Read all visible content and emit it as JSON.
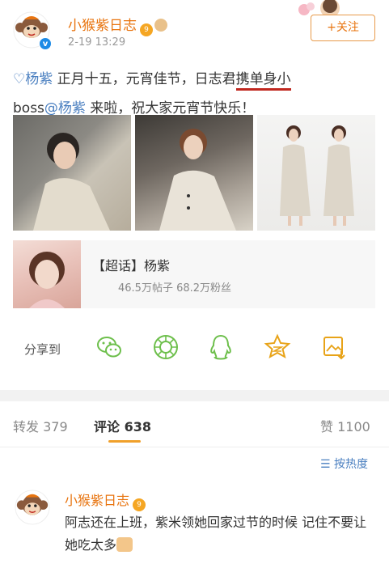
{
  "post": {
    "username": "小猴紫日志",
    "timestamp": "2-19 13:29",
    "follow_label": "+关注",
    "text": {
      "mention1": "♡杨紫",
      "part1": " 正月十五，元宵佳节，日志君",
      "underlined1": "携单身小",
      "underlined2": "boss",
      "mention2": "@杨紫",
      "part2": " 来啦，祝大家元宵节快乐！"
    },
    "topic": {
      "title": "【超话】杨紫",
      "stats": "46.5万帖子 68.2万粉丝"
    },
    "share_label": "分享到",
    "share_icons": [
      "wechat-icon",
      "moments-icon",
      "qq-icon",
      "qzone-icon",
      "save-image-icon"
    ]
  },
  "tabs": {
    "reposts": "转发 379",
    "comments": "评论 638",
    "likes": "赞 1100"
  },
  "sort_label": "按热度",
  "comment": {
    "username": "小猴紫日志",
    "text": "阿志还在上班，紫米领她回家过节的时候 记住不要让她吃太多"
  },
  "colors": {
    "username": "#e8740f",
    "link": "#4a7fc0",
    "underline": "#c0271f",
    "share_icon": "#6dbf4b"
  }
}
